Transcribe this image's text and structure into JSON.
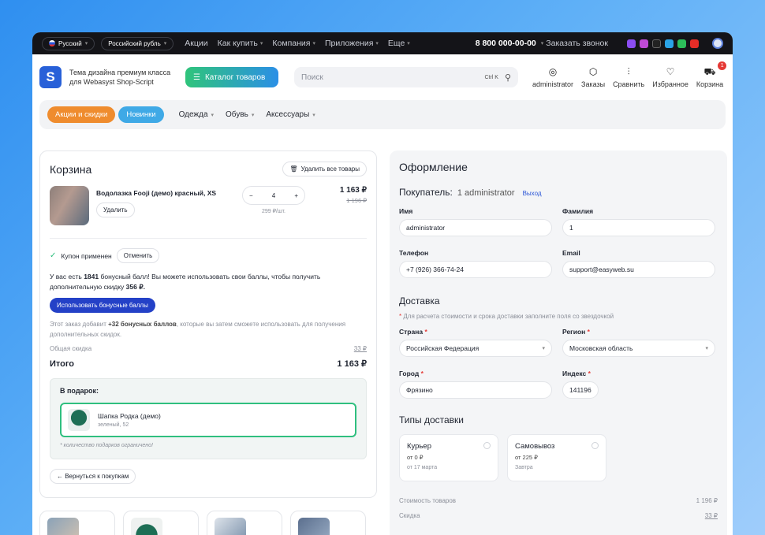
{
  "topbar": {
    "language": "Русский",
    "currency": "Российский рубль",
    "menu": [
      "Акции",
      "Как купить",
      "Компания",
      "Приложения",
      "Еще"
    ],
    "phone": "8 800 000-00-00",
    "callback": "Заказать звонок"
  },
  "header": {
    "logo_letter": "S",
    "tagline": "Тема дизайна премиум класса для Webasyst Shop-Script",
    "catalog_button": "Каталог товаров",
    "search_placeholder": "Поиск",
    "search_shortcut": "Ctrl K",
    "user": "administrator",
    "orders": "Заказы",
    "compare": "Сравнить",
    "favorites": "Избранное",
    "cart": "Корзина",
    "cart_count": "1"
  },
  "catnav": {
    "promo": "Акции и скидки",
    "new": "Новинки",
    "links": [
      "Одежда",
      "Обувь",
      "Аксессуары"
    ]
  },
  "cart": {
    "title": "Корзина",
    "clear_all": "Удалить все товары",
    "item_name": "Водолазка Fooji (демо)  красный, XS",
    "remove": "Удалить",
    "qty": "4",
    "unit_price": "299 ₽/шт.",
    "price": "1 163 ₽",
    "old_price": "1 196 ₽",
    "coupon_applied": "Купон применен",
    "cancel": "Отменить",
    "bonus_pre": "У вас есть",
    "bonus_count": "1841",
    "bonus_mid": "бонусный балл! Вы можете использовать свои баллы, чтобы получить дополнительную скидку",
    "bonus_discount": "356 ₽.",
    "use_bonus": "Использовать бонусные баллы",
    "earn_pre": "Этот заказ добавит",
    "earn_points": "+32 бонусных баллов",
    "earn_post": ", которые вы затем сможете использовать для получения дополнительных скидок.",
    "discount_label": "Общая скидка",
    "discount_value": "33 ₽",
    "total_label": "Итого",
    "total_value": "1 163 ₽",
    "gift_title": "В подарок:",
    "gift_name": "Шапка Родка (демо)",
    "gift_variant": "зеленый, 52",
    "gift_note": "* количество подарков ограничено!",
    "back": "← Вернуться к покупкам"
  },
  "order": {
    "title": "Оформление",
    "buyer_label": "Покупатель:",
    "buyer_name": "1 administrator",
    "logout": "Выход",
    "first_name_label": "Имя",
    "first_name": "administrator",
    "last_name_label": "Фамилия",
    "last_name": "1",
    "phone_label": "Телефон",
    "phone": "+7 (926) 366-74-24",
    "email_label": "Email",
    "email": "support@easyweb.su",
    "delivery_title": "Доставка",
    "delivery_note": "Для расчета стоимости и срока доставки заполните поля со звездочкой",
    "country_label": "Страна",
    "country": "Российская Федерация",
    "region_label": "Регион",
    "region": "Московская область",
    "city_label": "Город",
    "city": "Фрязино",
    "zip_label": "Индекс",
    "zip": "141196",
    "types_title": "Типы доставки",
    "courier": "Курьер",
    "courier_price": "от 0 ₽",
    "courier_date": "от 17 марта",
    "pickup": "Самовывоз",
    "pickup_price": "от 225 ₽",
    "pickup_date": "Завтра",
    "goods_cost_label": "Стоимость товаров",
    "goods_cost": "1 196 ₽",
    "discount_label": "Скидка",
    "discount": "33 ₽"
  },
  "colors": {
    "accent": "#2441c7",
    "green": "#2fbf7f",
    "promo": "#ef8c2e",
    "new": "#3fa9e6"
  }
}
